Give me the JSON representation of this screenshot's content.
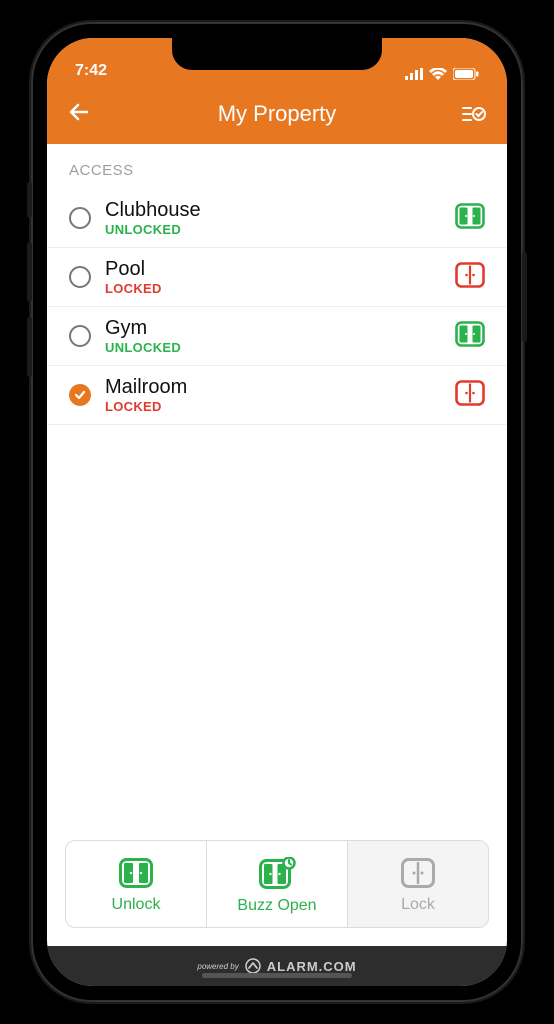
{
  "statusbar": {
    "time": "7:42"
  },
  "header": {
    "title": "My Property"
  },
  "section_label": "ACCESS",
  "colors": {
    "accent": "#e87722",
    "green": "#2bb24c",
    "red": "#e23b2e",
    "gray": "#9e9e9e"
  },
  "items": [
    {
      "name": "Clubhouse",
      "status": "UNLOCKED",
      "locked": false,
      "selected": false
    },
    {
      "name": "Pool",
      "status": "LOCKED",
      "locked": true,
      "selected": false
    },
    {
      "name": "Gym",
      "status": "UNLOCKED",
      "locked": false,
      "selected": false
    },
    {
      "name": "Mailroom",
      "status": "LOCKED",
      "locked": true,
      "selected": true
    }
  ],
  "actions": {
    "unlock": {
      "label": "Unlock",
      "enabled": true
    },
    "buzz": {
      "label": "Buzz Open",
      "enabled": true
    },
    "lock": {
      "label": "Lock",
      "enabled": false
    }
  },
  "footer": {
    "powered": "powered by",
    "brand": "ALARM.COM"
  }
}
